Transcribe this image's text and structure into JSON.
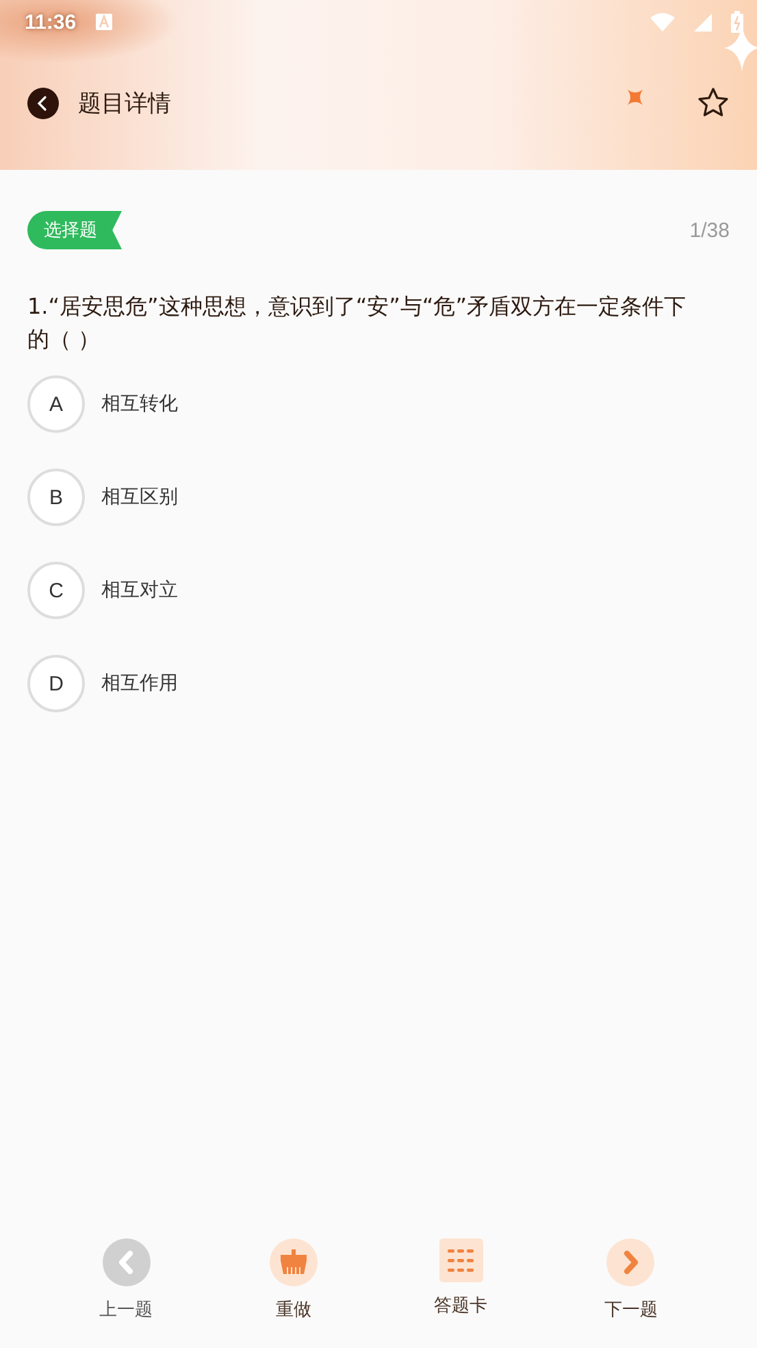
{
  "status_bar": {
    "time": "11:36"
  },
  "header": {
    "title": "题目详情",
    "favorited": false
  },
  "question": {
    "type_tag": "选择题",
    "progress": "1/38",
    "text": "1.“居安思危”这种思想，意识到了“安”与“危”矛盾双方在一定条件下的（    ）",
    "options": [
      {
        "letter": "A",
        "text": "相互转化",
        "selected": false
      },
      {
        "letter": "B",
        "text": "相互区别",
        "selected": false
      },
      {
        "letter": "C",
        "text": "相互对立",
        "selected": false
      },
      {
        "letter": "D",
        "text": "相互作用",
        "selected": false
      }
    ]
  },
  "bottom_bar": [
    {
      "kind": "prev",
      "label": "上一题",
      "disabled": true
    },
    {
      "kind": "redo",
      "label": "重做",
      "disabled": false
    },
    {
      "kind": "card",
      "label": "答题卡",
      "disabled": false
    },
    {
      "kind": "next",
      "label": "下一题",
      "disabled": false
    }
  ]
}
